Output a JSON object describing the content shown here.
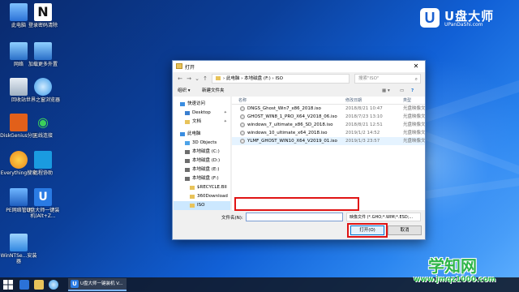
{
  "desktop_icons": [
    {
      "label": "此电脑",
      "color": "#3a8de0"
    },
    {
      "label": "网络",
      "color": "#3a7fd0"
    },
    {
      "label": "回收站",
      "color": "#b8c4d0"
    },
    {
      "label": "DiskGenius分区",
      "color": "#e2601a"
    },
    {
      "label": "Everything搜索",
      "color": "#f29a1a"
    },
    {
      "label": "PE网络管理",
      "color": "#2a70c8"
    },
    {
      "label": "WinNTSe...安装器",
      "color": "#3a9ae8"
    },
    {
      "label": "登录密码清除",
      "color": "#222222"
    },
    {
      "label": "加载更多外置",
      "color": "#3a7fd0"
    },
    {
      "label": "世界之窗浏览器",
      "color": "#3a9ae8"
    },
    {
      "label": "无线连接",
      "color": "#2fae4a"
    },
    {
      "label": "远程协助",
      "color": "#1a9be0"
    },
    {
      "label": "U盘大师一键装机(Alt+Z...",
      "color": "#2a7be4"
    }
  ],
  "logo": {
    "title": "U盘大师",
    "subtitle": "UPanDaShi.com",
    "letter": "U"
  },
  "dialog": {
    "title": "打开",
    "close": "✕",
    "address": [
      "此电脑",
      "本地磁盘 (F:)",
      "ISO"
    ],
    "search_placeholder": "搜索\"ISO\"",
    "toolbar": {
      "organize": "组织 ▾",
      "new_folder": "新建文件夹"
    },
    "nav_items": [
      {
        "label": "快速访问",
        "indent": 0,
        "color": "#3a8de0"
      },
      {
        "label": "Desktop",
        "indent": 1,
        "color": "#3a7fd0",
        "pin": true
      },
      {
        "label": "文档",
        "indent": 1,
        "color": "#e8c35a",
        "pin": true
      },
      {
        "label": "此电脑",
        "indent": 0,
        "color": "#3a8de0"
      },
      {
        "label": "3D Objects",
        "indent": 1,
        "color": "#4da3e8"
      },
      {
        "label": "本地磁盘 (C:)",
        "indent": 1,
        "color": "#6d6d6d"
      },
      {
        "label": "本地磁盘 (D:)",
        "indent": 1,
        "color": "#6d6d6d"
      },
      {
        "label": "本地磁盘 (E:)",
        "indent": 1,
        "color": "#6d6d6d"
      },
      {
        "label": "本地磁盘 (F:)",
        "indent": 1,
        "color": "#6d6d6d"
      },
      {
        "label": "$RECYCLE.BII",
        "indent": 2,
        "color": "#e8c35a"
      },
      {
        "label": "360Download",
        "indent": 2,
        "color": "#e8c35a"
      },
      {
        "label": "ISO",
        "indent": 2,
        "color": "#e8c35a"
      }
    ],
    "columns": {
      "name": "名称",
      "date": "修改日期",
      "type": "类型"
    },
    "files": [
      {
        "name": "DNGS_Ghost_Win7_x86_2018.iso",
        "date": "2018/8/21 10:47",
        "type": "光盘映像文"
      },
      {
        "name": "GHOST_WIN8_1_PRO_X64_V2018_06.iso",
        "date": "2018/7/23 13:10",
        "type": "光盘映像文"
      },
      {
        "name": "windows_7_ultimate_x86_SD_2018.iso",
        "date": "2018/8/21 12:51",
        "type": "光盘映像文"
      },
      {
        "name": "windows_10_ultimate_x64_2018.iso",
        "date": "2019/1/2 14:52",
        "type": "光盘映像文"
      },
      {
        "name": "YLMF_GHOST_WIN10_X64_V2019_01.iso",
        "date": "2019/1/3 23:57",
        "type": "光盘映像文"
      }
    ],
    "filename_label": "文件名(N):",
    "filename_value": "",
    "filetype_value": "映像文件 (*.GHO;*.WIM;*.ESD;...",
    "open_button": "打开(O)",
    "cancel_button": "取消"
  },
  "taskbar": {
    "app_label": "U盘大师一键装机 V..."
  },
  "watermark": {
    "title": "学知网",
    "url": "www.jmqz1000.com"
  }
}
